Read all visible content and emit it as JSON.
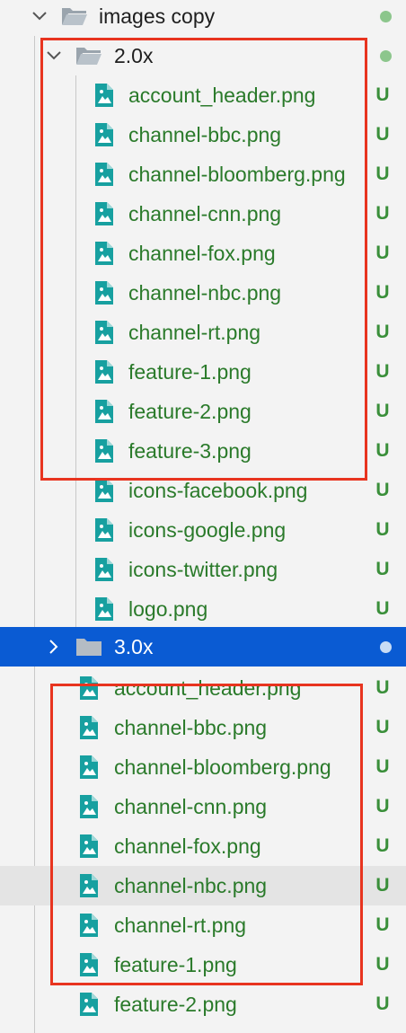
{
  "colors": {
    "selected_bg": "#0a5bd3",
    "untracked_green": "#2a7a2a",
    "status_dot_green": "#8cc68c",
    "status_dot_light": "#c8dcf5",
    "highlight_red": "#e8341f",
    "file_icon_teal": "#17a0a0"
  },
  "tree": {
    "root_folder": {
      "label": "images copy",
      "icon": "folder-open-icon",
      "expanded": true
    },
    "folder_2x": {
      "label": "2.0x",
      "icon": "folder-open-icon",
      "expanded": true
    },
    "files_2x": [
      {
        "label": "account_header.png",
        "status": "U"
      },
      {
        "label": "channel-bbc.png",
        "status": "U"
      },
      {
        "label": "channel-bloomberg.png",
        "status": "U"
      },
      {
        "label": "channel-cnn.png",
        "status": "U"
      },
      {
        "label": "channel-fox.png",
        "status": "U"
      },
      {
        "label": "channel-nbc.png",
        "status": "U"
      },
      {
        "label": "channel-rt.png",
        "status": "U"
      },
      {
        "label": "feature-1.png",
        "status": "U"
      },
      {
        "label": "feature-2.png",
        "status": "U"
      },
      {
        "label": "feature-3.png",
        "status": "U"
      },
      {
        "label": "icons-facebook.png",
        "status": "U"
      },
      {
        "label": "icons-google.png",
        "status": "U"
      },
      {
        "label": "icons-twitter.png",
        "status": "U"
      },
      {
        "label": "logo.png",
        "status": "U"
      }
    ],
    "folder_3x": {
      "label": "3.0x",
      "icon": "folder-closed-icon",
      "expanded": false,
      "selected": true
    },
    "files_3x": [
      {
        "label": "account_header.png",
        "status": "U"
      },
      {
        "label": "channel-bbc.png",
        "status": "U"
      },
      {
        "label": "channel-bloomberg.png",
        "status": "U"
      },
      {
        "label": "channel-cnn.png",
        "status": "U"
      },
      {
        "label": "channel-fox.png",
        "status": "U"
      },
      {
        "label": "channel-nbc.png",
        "status": "U"
      },
      {
        "label": "channel-rt.png",
        "status": "U"
      },
      {
        "label": "feature-1.png",
        "status": "U"
      },
      {
        "label": "feature-2.png",
        "status": "U"
      }
    ]
  }
}
